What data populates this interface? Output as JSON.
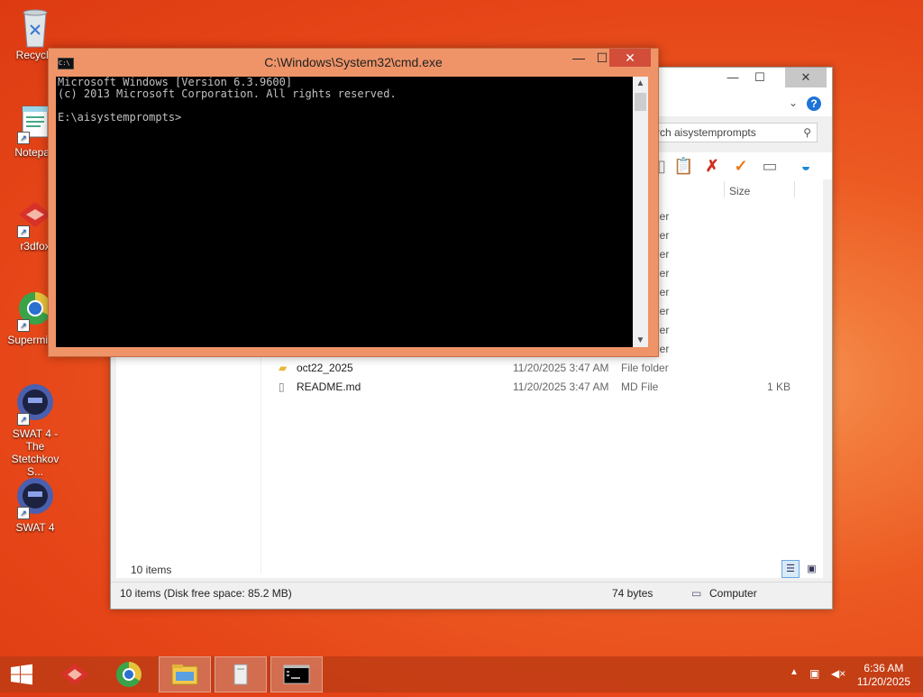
{
  "desktop": {
    "icons": [
      {
        "label": "Recycle"
      },
      {
        "label": "Notepad"
      },
      {
        "label": "r3dfox"
      },
      {
        "label": "Supermium"
      },
      {
        "label": "SWAT 4 - The Stetchkov S..."
      },
      {
        "label": "SWAT 4"
      }
    ]
  },
  "cmd": {
    "title": "C:\\Windows\\System32\\cmd.exe",
    "lines": [
      "Microsoft Windows [Version 6.3.9600]",
      "(c) 2013 Microsoft Corporation. All rights reserved.",
      "",
      "E:\\aisystemprompts>"
    ]
  },
  "explorer": {
    "search_placeholder": "rch aisystemprompts",
    "column_size": "Size",
    "partial_type": "ler",
    "rows": [
      {
        "name": "oct22_2025",
        "date": "11/20/2025 3:47 AM",
        "type": "File folder",
        "size": ""
      },
      {
        "name": "README.md",
        "date": "11/20/2025 3:47 AM",
        "type": "MD File",
        "size": "1 KB"
      }
    ],
    "item_count": "10 items",
    "status_left": "10 items (Disk free space: 85.2 MB)",
    "status_mid": "74 bytes",
    "status_right": "Computer"
  },
  "taskbar": {
    "time": "6:36 AM",
    "date": "11/20/2025"
  },
  "colors": {
    "desktop": "#e64618",
    "cmd_frame": "#ef9468",
    "close_red": "#d24d3a"
  }
}
